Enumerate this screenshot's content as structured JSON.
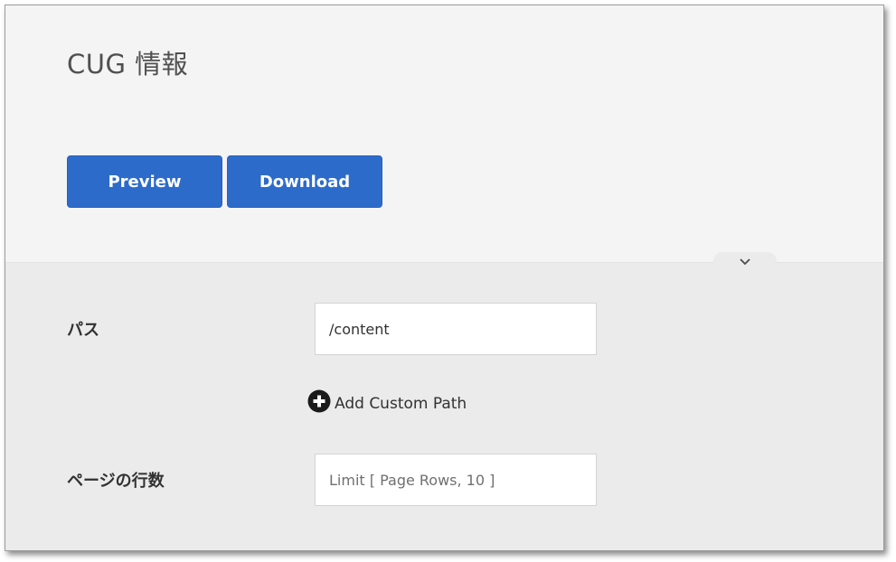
{
  "header": {
    "title": "CUG 情報",
    "buttons": {
      "preview": "Preview",
      "download": "Download"
    }
  },
  "form": {
    "path": {
      "label": "パス",
      "value": "/content"
    },
    "add_custom_path": {
      "label": "Add Custom Path",
      "icon": "plus-circle-icon"
    },
    "page_rows": {
      "label": "ページの行数",
      "placeholder": "Limit [ Page Rows, 10 ]"
    }
  },
  "collapse_icon": "chevron-down-icon",
  "colors": {
    "primary_button": "#2d6bcb",
    "header_bg": "#f4f4f4",
    "form_bg": "#ebebeb",
    "text": "#323232"
  }
}
